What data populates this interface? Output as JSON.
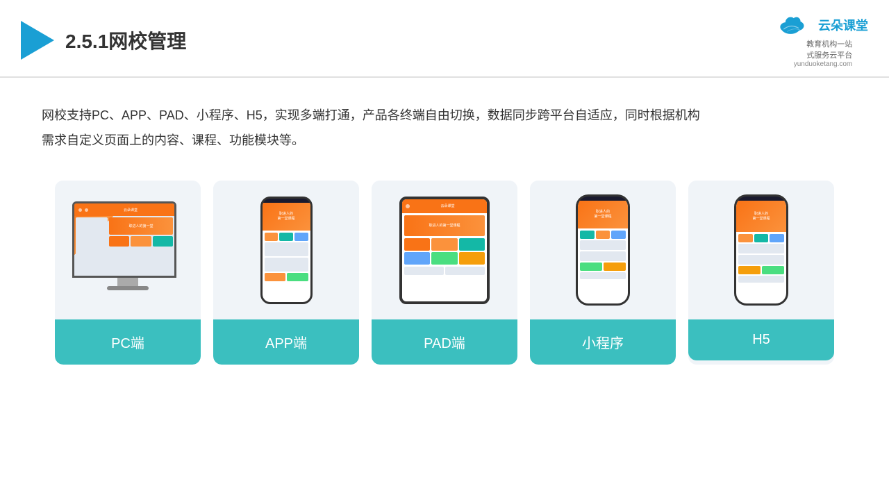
{
  "header": {
    "title": "2.5.1网校管理",
    "brand_name": "云朵课堂",
    "brand_url": "yunduoketang.com",
    "brand_tagline": "教育机构一站\n式服务云平台"
  },
  "description": "网校支持PC、APP、PAD、小程序、H5，实现多端打通，产品各终端自由切换，数据同步跨平台自适应，同时根据机构\n需求自定义页面上的内容、课程、功能模块等。",
  "cards": [
    {
      "id": "pc",
      "label": "PC端"
    },
    {
      "id": "app",
      "label": "APP端"
    },
    {
      "id": "pad",
      "label": "PAD端"
    },
    {
      "id": "miniapp",
      "label": "小程序"
    },
    {
      "id": "h5",
      "label": "H5"
    }
  ],
  "colors": {
    "teal": "#3bbfbf",
    "brand_blue": "#1a9fd4",
    "header_line": "#e0e0e0"
  }
}
